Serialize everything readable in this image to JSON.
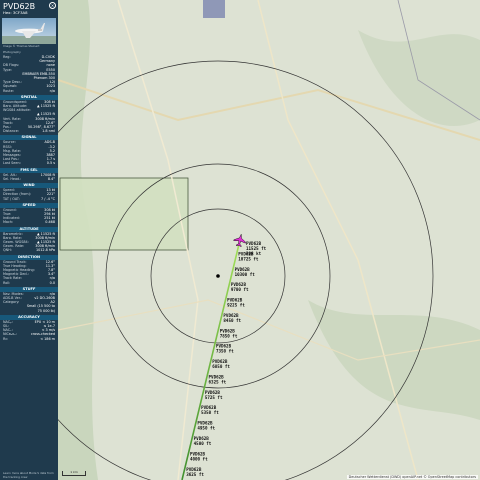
{
  "sidebar": {
    "callsign": "PVD62B",
    "hex_line": "Hex:  3CF3A8",
    "photo_credit": "Image © Thomas Steinert",
    "photo_source": "Photography",
    "rows_top": [
      {
        "k": "Reg:",
        "v": "D-CVDK"
      },
      {
        "k": "",
        "v": "Germany"
      },
      {
        "k": "DB Flags:",
        "v": "none"
      },
      {
        "k": "Type:",
        "v": "E550"
      },
      {
        "k": "",
        "v": "EMBRAER EMB-550"
      },
      {
        "k": "",
        "v": "Phenom 300"
      },
      {
        "k": "Type Desc.:",
        "v": "L2J"
      },
      {
        "k": "Squawk:",
        "v": "1023"
      },
      {
        "k": "Route:",
        "v": "n/a"
      }
    ],
    "sections": [
      {
        "title": "SPATIAL",
        "rows": [
          {
            "k": "Groundspeed:",
            "v": "308 kt"
          },
          {
            "k": "Baro. Altitude:",
            "v": "▲ 11525 ft"
          },
          {
            "k": "WGS84 altitude:",
            "v": ""
          },
          {
            "k": "",
            "v": "▲ 11525 ft"
          },
          {
            "k": "Vert. Rate:",
            "v": "3008 ft/min"
          },
          {
            "k": "Track:",
            "v": "12.6°"
          },
          {
            "k": "Pos.:",
            "v": "50.298°, 8.677°"
          },
          {
            "k": "Distance:",
            "v": "1.8 nmi"
          }
        ]
      },
      {
        "title": "SIGNAL",
        "rows": [
          {
            "k": "Source:",
            "v": "ADS-B"
          },
          {
            "k": "RSSI:",
            "v": "-3.2"
          },
          {
            "k": "Msg. Rate:",
            "v": "5.2"
          },
          {
            "k": "Messages:",
            "v": "3887"
          },
          {
            "k": "Last Pos.:",
            "v": "1.7 s"
          },
          {
            "k": "Last Seen:",
            "v": "0.5 s"
          }
        ]
      },
      {
        "title": "FMS SEL",
        "rows": [
          {
            "k": "Sel. Alt.:",
            "v": "17008 ft"
          },
          {
            "k": "Sel. Head.:",
            "v": "8.4°"
          }
        ]
      },
      {
        "title": "WIND",
        "rows": [
          {
            "k": "Speed:",
            "v": "13 kt"
          },
          {
            "k": "Direction (from):",
            "v": "221°"
          },
          {
            "k": "TAT / OAT:",
            "v": "7 / -4 °C"
          }
        ]
      },
      {
        "title": "SPEED",
        "rows": [
          {
            "k": "Ground:",
            "v": "308 kt"
          },
          {
            "k": "True:",
            "v": "294 kt"
          },
          {
            "k": "Indicated:",
            "v": "251 kt"
          },
          {
            "k": "Mach:",
            "v": "0.468"
          }
        ]
      },
      {
        "title": "ALTITUDE",
        "rows": [
          {
            "k": "Barometric:",
            "v": "▲ 11525 ft"
          },
          {
            "k": "Baro. Rate:",
            "v": "3008 ft/min"
          },
          {
            "k": "Geom. WGS84:",
            "v": "▲ 11525 ft"
          },
          {
            "k": "Geom. Rate:",
            "v": "3008 ft/min"
          },
          {
            "k": "QNH:",
            "v": "1012.8 hPa"
          }
        ]
      },
      {
        "title": "DIRECTION",
        "rows": [
          {
            "k": "Ground Track:",
            "v": "12.6°"
          },
          {
            "k": "True Heading:",
            "v": "11.3°"
          },
          {
            "k": "Magnetic Heading:",
            "v": "7.8°"
          },
          {
            "k": "Magnetic Decl.:",
            "v": "3.4°"
          },
          {
            "k": "Track Rate:",
            "v": "n/a"
          },
          {
            "k": "Roll:",
            "v": "0.0"
          }
        ]
      },
      {
        "title": "STUFF",
        "rows": [
          {
            "k": "Nav. Modes:",
            "v": "n/a"
          },
          {
            "k": "ADS-B Ver.:",
            "v": "v2 DO-260B"
          },
          {
            "k": "Category:",
            "v": "A2"
          },
          {
            "k": "",
            "v": "Small (15 500 to"
          },
          {
            "k": "",
            "v": "75 000 lb)"
          }
        ]
      },
      {
        "title": "ACCURACY",
        "rows": [
          {
            "k": "NACₚ:",
            "v": "EPU < 10 m"
          },
          {
            "k": "SIL:",
            "v": "≤ 1e-7"
          },
          {
            "k": "NACᵥ:",
            "v": "< 3 m/s"
          },
          {
            "k": "NICʙₐʀₒ:",
            "v": "cross-checked"
          },
          {
            "k": "Rc:",
            "v": "< 186 m"
          }
        ]
      }
    ],
    "footer": "Learn more about Mode S data from the tracking crew"
  },
  "map": {
    "attribution": "Deutscher Wetterdienst (DWD) openAIP.net © OpenStreetMap contributors",
    "scale_label": "1 km",
    "aircraft_label": [
      "PVD62B",
      "11525 ft",
      "308 kt"
    ],
    "track_label_sets": [
      [
        "PVD62B",
        "10725 ft"
      ],
      [
        "PVD62B",
        "10300 ft"
      ],
      [
        "PVD62B",
        "9700 ft"
      ],
      [
        "PVD62B",
        "9225 ft"
      ],
      [
        "PVD62B",
        "8450 ft"
      ],
      [
        "PVD62B",
        "7850 ft"
      ],
      [
        "PVD62B",
        "7350 ft"
      ],
      [
        "PVD62B",
        "6850 ft"
      ],
      [
        "PVD62B",
        "6325 ft"
      ],
      [
        "PVD62B",
        "5725 ft"
      ],
      [
        "PVD62B",
        "5350 ft"
      ],
      [
        "PVD62B",
        "4950 ft"
      ],
      [
        "PVD62B",
        "4500 ft"
      ],
      [
        "PVD62B",
        "4000 ft"
      ],
      [
        "PVD62B",
        "3625 ft"
      ]
    ],
    "colors": {
      "track_start": "#3f8f2e",
      "track_end": "#a4e05a",
      "aircraft": "#e02fd6",
      "range_ring": "#333333",
      "sidebar": "#1f3a4d",
      "section": "#17587a"
    }
  }
}
